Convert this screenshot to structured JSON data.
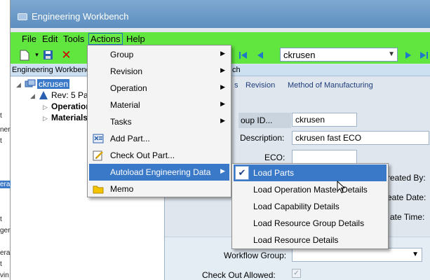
{
  "window": {
    "title": "Engineering Workbench"
  },
  "menubar": {
    "file": "File",
    "edit": "Edit",
    "tools": "Tools",
    "actions": "Actions",
    "help": "Help"
  },
  "toolbar": {
    "record_value": "ckrusen"
  },
  "header_strip": {
    "left_text": "Engineering Workbench",
    "right_text": "ch"
  },
  "tree": {
    "root": "ckrusen",
    "rev": "Rev: 5 Par",
    "operations": "Operation",
    "materials": "Materials"
  },
  "tabs": {
    "tab1": "s",
    "tab2": "Revision",
    "tab3": "Method of Manufacturing"
  },
  "form": {
    "group_id_label": "oup ID...",
    "group_id_value": "ckrusen",
    "description_label": "Description:",
    "description_value": "ckrusen fast ECO",
    "eco_label": "ECO:",
    "created_by_label": "reated By:",
    "create_date_label": "eate Date:",
    "create_time_label": "ate Time:",
    "workflow_group_label": "Workflow Group:",
    "checkout_allowed_label": "Check Out Allowed:"
  },
  "bg_fragments": [
    "t",
    "ner",
    "t",
    "era",
    "t",
    "ger",
    "era",
    "t",
    "vin"
  ],
  "actions_menu": {
    "items": [
      {
        "label": "Group",
        "has_submenu": true,
        "icon": ""
      },
      {
        "label": "Revision",
        "has_submenu": true,
        "icon": ""
      },
      {
        "label": "Operation",
        "has_submenu": true,
        "icon": ""
      },
      {
        "label": "Material",
        "has_submenu": true,
        "icon": ""
      },
      {
        "label": "Tasks",
        "has_submenu": true,
        "icon": ""
      },
      {
        "label": "Add Part...",
        "has_submenu": false,
        "icon": "add-part-icon"
      },
      {
        "label": "Check Out Part...",
        "has_submenu": false,
        "icon": "check-out-icon"
      },
      {
        "label": "Autoload Engineering Data",
        "has_submenu": true,
        "icon": ""
      },
      {
        "label": "Memo",
        "has_submenu": false,
        "icon": "memo-icon"
      }
    ]
  },
  "autoload_menu": {
    "items": [
      {
        "label": "Load Parts",
        "checked": true
      },
      {
        "label": "Load Operation Master Details",
        "checked": false
      },
      {
        "label": "Load Capability Details",
        "checked": false
      },
      {
        "label": "Load Resource Group Details",
        "checked": false
      },
      {
        "label": "Load Resource Details",
        "checked": false
      }
    ]
  },
  "colors": {
    "menubar_green": "#61e53f",
    "selection_blue": "#3a78c8",
    "titlebar_blue": "#6b99c8"
  }
}
